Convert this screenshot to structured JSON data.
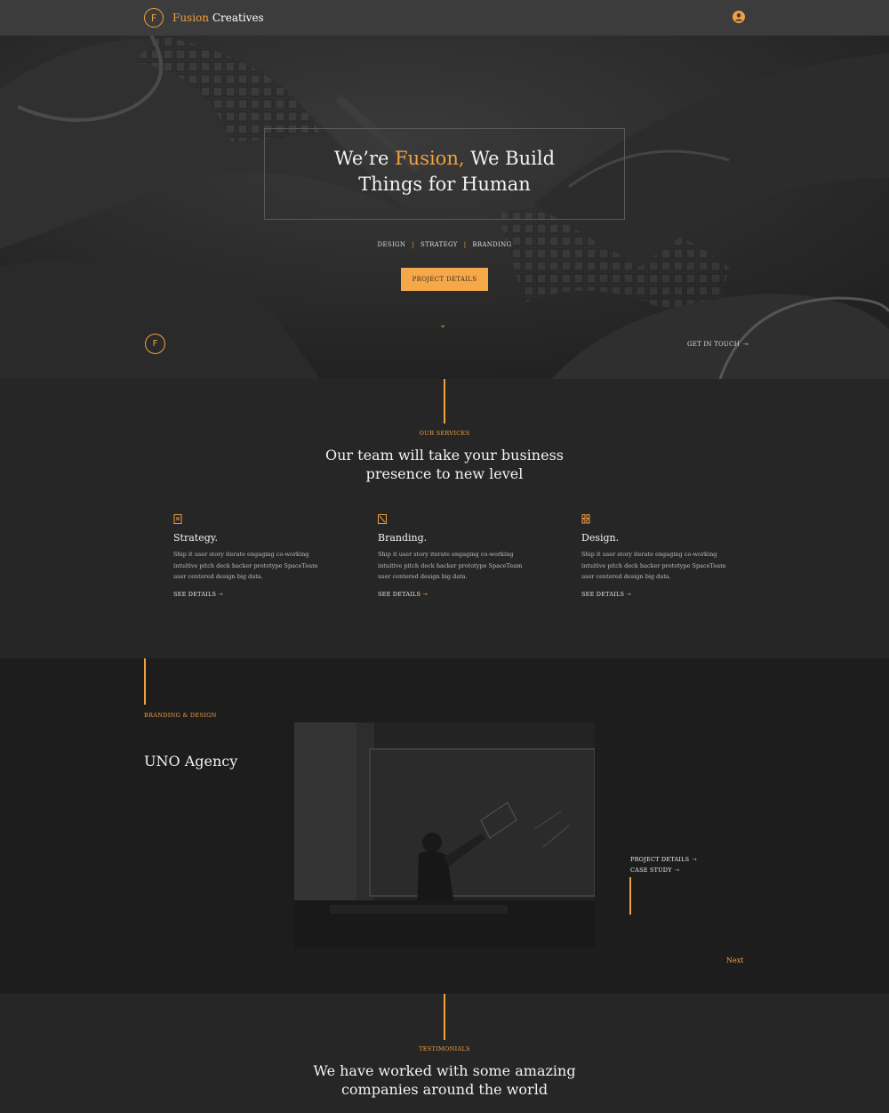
{
  "header": {
    "logo_letter": "F",
    "brand_part1": "Fusion",
    "brand_part2": "Creatives",
    "user_icon": "user-icon"
  },
  "hero": {
    "title_pre": "We’re ",
    "title_accent": "Fusion,",
    "title_post": " We Build",
    "title_line2": "Things for Human",
    "tags": [
      "DESIGN",
      "STRATEGY",
      "BRANDING"
    ],
    "tag_separator": "|",
    "button_label": "PROJECT DETAILS",
    "chevron_icon": "chevron-down-icon",
    "logo_letter": "F",
    "get_in_touch": "GET IN TOUCH",
    "arrow": "→"
  },
  "services": {
    "label": "OUR SERVICES",
    "title_line1": "Our team will take your business",
    "title_line2": "presence to new level",
    "items": [
      {
        "icon": "document-icon",
        "name": "Strategy.",
        "desc": "Ship it user story iterate engaging co-working intuitive pitch deck hacker prototype SpaceTeam user centered design big data.",
        "link": "SEE DETAILS"
      },
      {
        "icon": "pen-icon",
        "name": "Branding.",
        "desc": "Ship it user story iterate engaging co-working intuitive pitch deck hacker prototype SpaceTeam user centered design big data.",
        "link": "SEE DETAILS"
      },
      {
        "icon": "palette-icon",
        "name": "Design.",
        "desc": "Ship it user story iterate engaging co-working intuitive pitch deck hacker prototype SpaceTeam user centered design big data.",
        "link": "SEE DETAILS"
      }
    ],
    "arrow": "→"
  },
  "project": {
    "label": "BRANDING & DESIGN",
    "title": "UNO Agency",
    "link1": "PROJECT DETAILS",
    "link2": "CASE STUDY",
    "next": "Next",
    "arrow": "→"
  },
  "testimonials": {
    "label": "TESTIMONIALS",
    "title_line1": "We have worked with some amazing",
    "title_line2": "companies around the world"
  },
  "colors": {
    "accent": "#f0a040",
    "button": "#f5a84a",
    "header_bg": "#3c3c3c",
    "section_bg": "#262626",
    "project_bg": "#1d1d1d"
  }
}
